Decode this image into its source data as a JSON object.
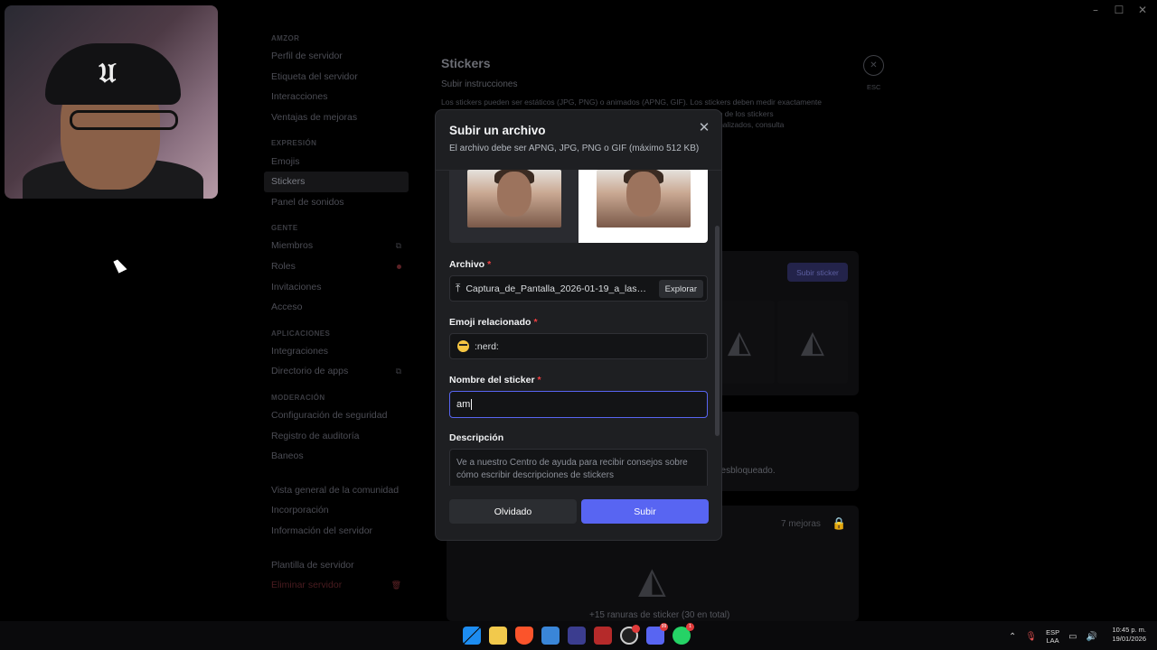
{
  "window": {
    "minimize": "–",
    "maximize": "☐",
    "close": "✕"
  },
  "sidebar": {
    "sections": [
      {
        "header": "AMZOR",
        "items": [
          {
            "label": "Perfil de servidor"
          },
          {
            "label": "Etiqueta del servidor"
          },
          {
            "label": "Interacciones"
          },
          {
            "label": "Ventajas de mejoras"
          }
        ]
      },
      {
        "header": "EXPRESIÓN",
        "items": [
          {
            "label": "Emojis"
          },
          {
            "label": "Stickers"
          },
          {
            "label": "Panel de sonidos"
          }
        ]
      },
      {
        "header": "GENTE",
        "items": [
          {
            "label": "Miembros"
          },
          {
            "label": "Roles"
          },
          {
            "label": "Invitaciones"
          },
          {
            "label": "Acceso"
          }
        ]
      },
      {
        "header": "APLICACIONES",
        "items": [
          {
            "label": "Integraciones"
          },
          {
            "label": "Directorio de apps"
          }
        ]
      },
      {
        "header": "MODERACIÓN",
        "items": [
          {
            "label": "Configuración de seguridad"
          },
          {
            "label": "Registro de auditoría"
          },
          {
            "label": "Baneos"
          }
        ]
      },
      {
        "header": "",
        "items": [
          {
            "label": "Vista general de la comunidad"
          },
          {
            "label": "Incorporación"
          },
          {
            "label": "Información del servidor"
          }
        ]
      },
      {
        "header": "",
        "items": [
          {
            "label": "Plantilla de servidor"
          },
          {
            "label": "Eliminar servidor"
          }
        ]
      }
    ]
  },
  "main": {
    "title": "Stickers",
    "subtitle": "Subir instrucciones",
    "text_line1": "Los stickers pueden ser estáticos (JPG, PNG) o animados (APNG, GIF). Los stickers deben medir exactamente",
    "text_line2": "320 x 320 px y no ocupar más de 512 KB. Nosotros redimensionaremos el tamaño de los stickers",
    "text_line3": "automáticamente. Para obtener más información sobre cómo crear stickers personalizados, consulta",
    "esc_label": "ESC",
    "upload_sticker_button": "Subir sticker",
    "unlocked_text": "desbloqueado.",
    "boosts_text": "7 mejoras",
    "slots_text": "+15 ranuras de sticker (30 en total)"
  },
  "modal": {
    "title": "Subir un archivo",
    "subtitle": "El archivo debe ser APNG, JPG, PNG o GIF (máximo 512 KB)",
    "file_label": "Archivo",
    "file_name": "Captura_de_Pantalla_2026-01-19_a_las_1...",
    "browse_label": "Explorar",
    "emoji_label": "Emoji relacionado",
    "emoji_value": ":nerd:",
    "name_label": "Nombre del sticker",
    "name_value": "am",
    "description_label": "Descripción",
    "description_placeholder": "Ve a nuestro Centro de ayuda para recibir consejos sobre cómo escribir descripciones de stickers",
    "required_mark": "*",
    "cancel_label": "Olvidado",
    "submit_label": "Subir",
    "accent_color": "#5865f2"
  },
  "taskbar": {
    "badge_discord": "99",
    "badge_whatsapp": "1",
    "lang_top": "ESP",
    "lang_bottom": "LAA",
    "time": "10:45 p. m.",
    "date": "19/01/2026"
  }
}
